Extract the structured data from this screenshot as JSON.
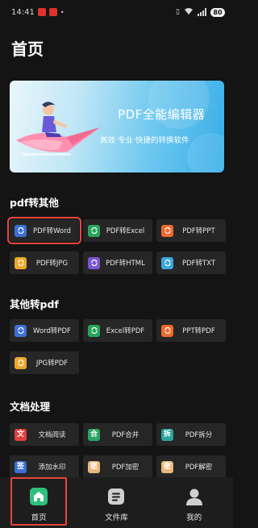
{
  "status_bar": {
    "time": "14:41",
    "battery": "80"
  },
  "page_title": "首页",
  "banner": {
    "title": "PDF全能编辑器",
    "subtitle": "高效·专业·快捷的转换软件"
  },
  "sections": [
    {
      "title": "pdf转其他",
      "items": [
        {
          "label": "PDF转Word",
          "icon": "word-convert-icon",
          "color": "#3d6fd8"
        },
        {
          "label": "PDF转Excel",
          "icon": "excel-convert-icon",
          "color": "#27a45b"
        },
        {
          "label": "PDF转PPT",
          "icon": "ppt-convert-icon",
          "color": "#ee6a2c"
        },
        {
          "label": "PDF转JPG",
          "icon": "jpg-convert-icon",
          "color": "#eda72a"
        },
        {
          "label": "PDF转HTML",
          "icon": "html-convert-icon",
          "color": "#7a55d6"
        },
        {
          "label": "PDF转TXT",
          "icon": "txt-convert-icon",
          "color": "#3aa7d9"
        }
      ]
    },
    {
      "title": "其他转pdf",
      "items": [
        {
          "label": "Word转PDF",
          "icon": "word-convert-icon",
          "color": "#3d6fd8"
        },
        {
          "label": "Excel转PDF",
          "icon": "excel-convert-icon",
          "color": "#27a45b"
        },
        {
          "label": "PPT转PDF",
          "icon": "ppt-convert-icon",
          "color": "#ee6a2c"
        },
        {
          "label": "JPG转PDF",
          "icon": "jpg-convert-icon",
          "color": "#eda72a"
        }
      ]
    },
    {
      "title": "文档处理",
      "items": [
        {
          "label": "文档阅读",
          "glyph": "文",
          "icon": "read-icon",
          "color": "#e0403c"
        },
        {
          "label": "PDF合并",
          "glyph": "合",
          "icon": "merge-icon",
          "color": "#2aa363"
        },
        {
          "label": "PDF拆分",
          "glyph": "拆",
          "icon": "split-icon",
          "color": "#2aa39a"
        },
        {
          "label": "添加水印",
          "glyph": "签",
          "icon": "watermark-icon",
          "color": "#3a6fd4"
        },
        {
          "label": "PDF加密",
          "glyph": "密",
          "icon": "encrypt-icon",
          "color": "#e8b97a"
        },
        {
          "label": "PDF解密",
          "glyph": "密",
          "icon": "decrypt-icon",
          "color": "#e8b97a"
        }
      ]
    }
  ],
  "bottom_nav": [
    {
      "label": "首页",
      "icon": "home-icon",
      "active": true
    },
    {
      "label": "文件库",
      "icon": "file-library-icon",
      "active": false
    },
    {
      "label": "我的",
      "icon": "profile-icon",
      "active": false
    }
  ],
  "colors": {
    "background": "#141414",
    "tile": "#262626",
    "highlight": "#e8453c",
    "active_nav": "#2fc07f"
  }
}
